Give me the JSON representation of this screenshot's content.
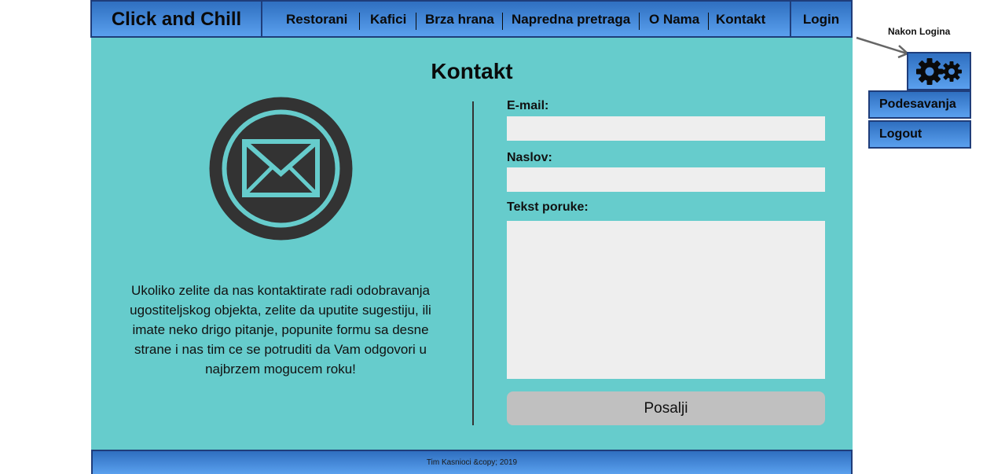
{
  "nav": {
    "brand": "Click and Chill",
    "items": [
      {
        "label": "Restorani"
      },
      {
        "label": "Kafici"
      },
      {
        "label": "Brza hrana"
      },
      {
        "label": "Napredna pretraga"
      },
      {
        "label": "O Nama"
      },
      {
        "label": "Kontakt"
      }
    ],
    "login": "Login"
  },
  "main": {
    "title": "Kontakt",
    "intro": "Ukoliko zelite da nas kontaktirate radi odobravanja ugostiteljskog objekta, zelite da uputite sugestiju, ili imate neko drigo pitanje, popunite formu sa desne strane i nas tim ce se potruditi da Vam odgovori u najbrzem mogucem roku!",
    "form": {
      "email_label": "E-mail:",
      "email_value": "",
      "subject_label": "Naslov:",
      "subject_value": "",
      "message_label": "Tekst poruke:",
      "message_value": "",
      "submit": "Posalji"
    }
  },
  "footer": {
    "text": "Tim Kasnioci &copy; 2019"
  },
  "annotation": {
    "label": "Nakon Logina",
    "menu": [
      {
        "label": "Podesavanja"
      },
      {
        "label": "Logout"
      }
    ]
  },
  "icons": {
    "contact": "envelope-icon",
    "settings": "gears-icon"
  },
  "colors": {
    "nav_gradient_top": "#2f6fc0",
    "nav_gradient_bottom": "#5aa0ee",
    "nav_border": "#1f3d7a",
    "content_bg": "#66cccc",
    "input_bg": "#eeeeee",
    "button_bg": "#c0c0c0",
    "icon_dark": "#333333"
  }
}
